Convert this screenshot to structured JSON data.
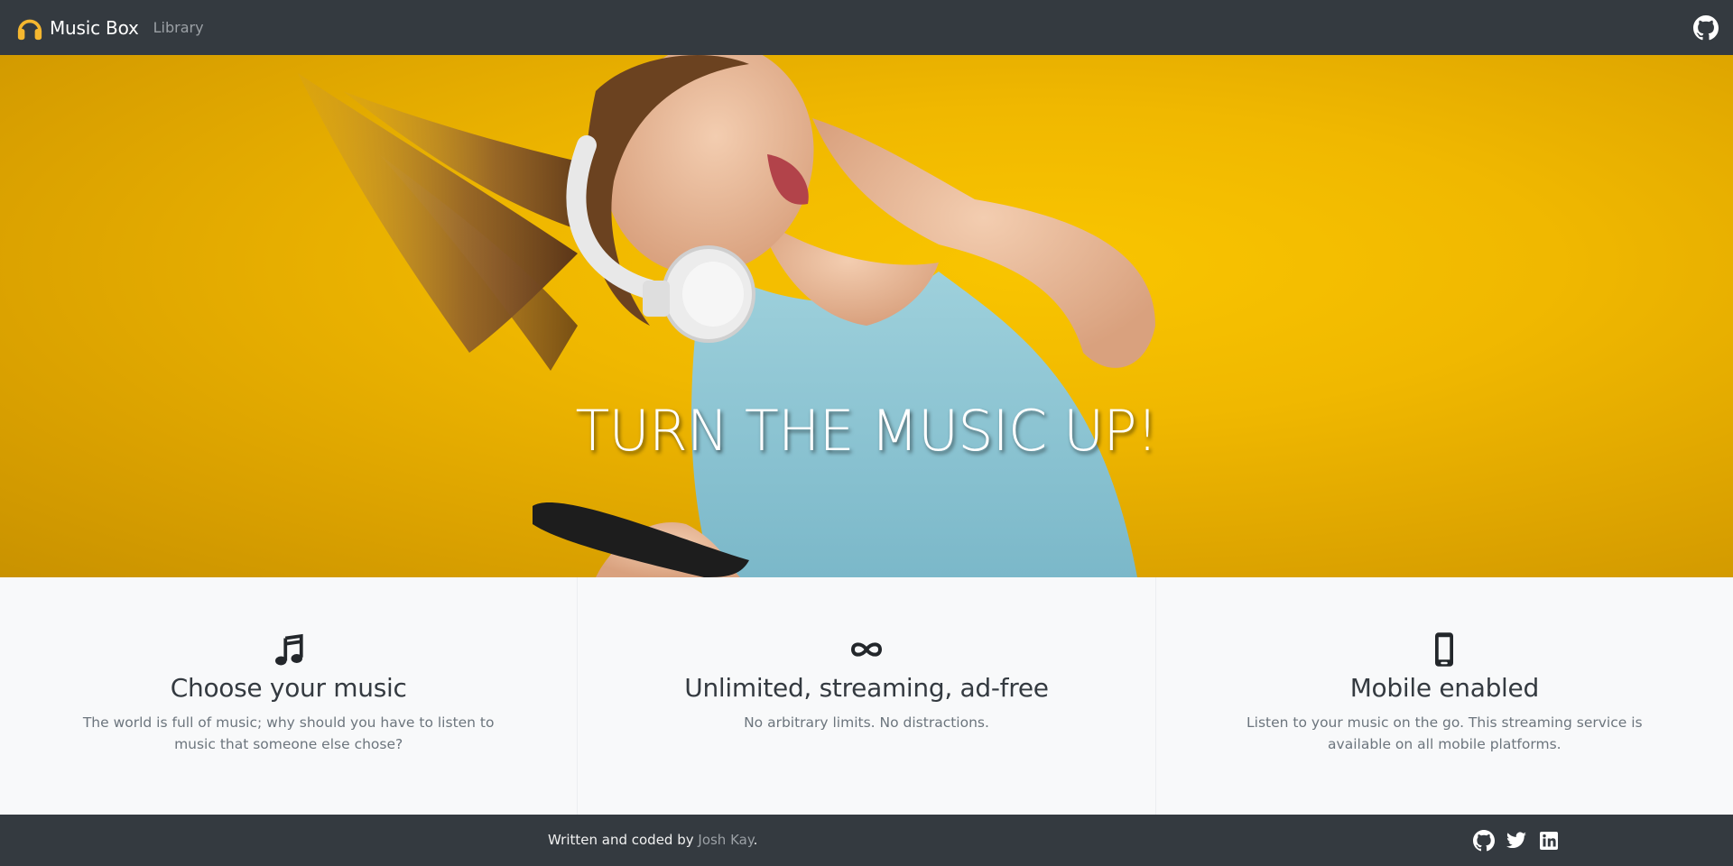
{
  "navbar": {
    "brand": "Music Box",
    "links": [
      "Library"
    ],
    "brand_icon": "headphones-icon",
    "right_icon": "github-icon",
    "brand_icon_color": "#f5b72f"
  },
  "hero": {
    "title": "TURN THE MUSIC UP!",
    "background_color": "#f2b900"
  },
  "features": [
    {
      "icon": "music-note-icon",
      "title": "Choose your music",
      "description": "The world is full of music; why should you have to listen to music that someone else chose?"
    },
    {
      "icon": "infinity-icon",
      "title": "Unlimited, streaming, ad-free",
      "description": "No arbitrary limits. No distractions."
    },
    {
      "icon": "mobile-phone-icon",
      "title": "Mobile enabled",
      "description": "Listen to your music on the go. This streaming service is available on all mobile platforms."
    }
  ],
  "footer": {
    "prefix": "Written and coded by ",
    "author": "Josh Kay",
    "suffix": ".",
    "social_icons": [
      "github-icon",
      "twitter-icon",
      "linkedin-icon"
    ]
  },
  "colors": {
    "navbar_bg": "#343a40",
    "feature_bg": "#f8f9fa",
    "text_dark": "#343a40",
    "text_muted": "#6c757d"
  }
}
